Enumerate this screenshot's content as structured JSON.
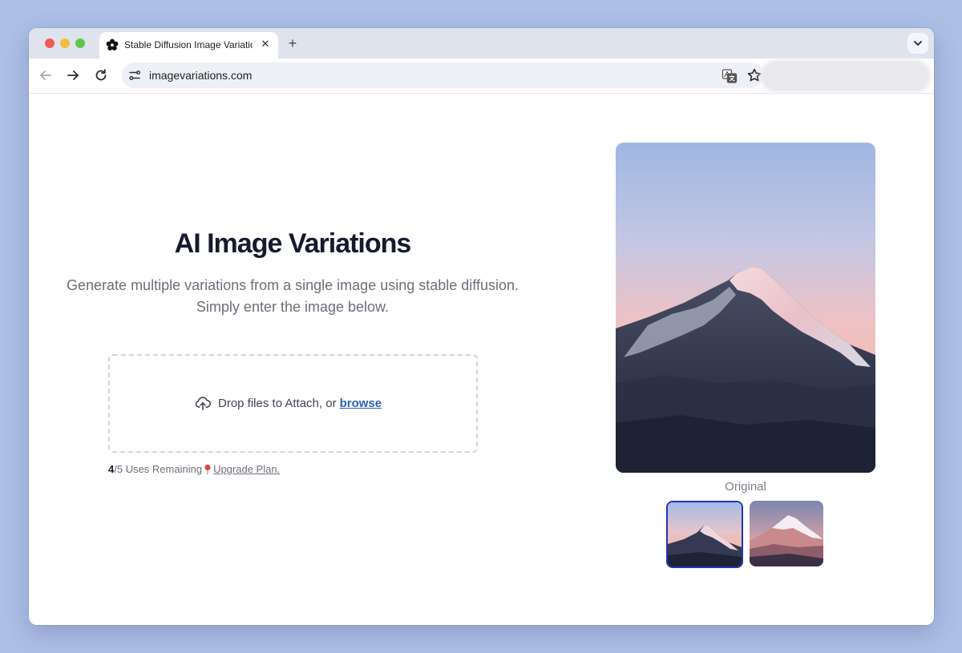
{
  "browser": {
    "tab": {
      "title": "Stable Diffusion Image Variations",
      "close_glyph": "✕",
      "favicon": "flower-favicon-icon"
    },
    "new_tab_glyph": "+",
    "address_bar": {
      "url": "imagevariations.com"
    },
    "icons": [
      "back-arrow-icon",
      "forward-arrow-icon",
      "reload-icon",
      "site-info-icon",
      "translate-icon",
      "bookmark-star-icon",
      "chevron-down-icon"
    ]
  },
  "page": {
    "title": "AI Image Variations",
    "subtitle_line1": "Generate multiple variations from a single image using stable diffusion.",
    "subtitle_line2": "Simply enter the image below.",
    "dropzone": {
      "text": "Drop files to Attach, or",
      "browse_label": "browse",
      "icon": "cloud-upload-icon"
    },
    "usage": {
      "used": "4",
      "rest": "/5 Uses Remaining",
      "upgrade_label": "Upgrade Plan."
    },
    "preview": {
      "caption": "Original",
      "thumbnails": 2
    }
  },
  "colors": {
    "background": "#aebfe6",
    "title": "#141b2e",
    "link": "#2c5fb5",
    "selected_thumb_border": "#2433b5"
  }
}
